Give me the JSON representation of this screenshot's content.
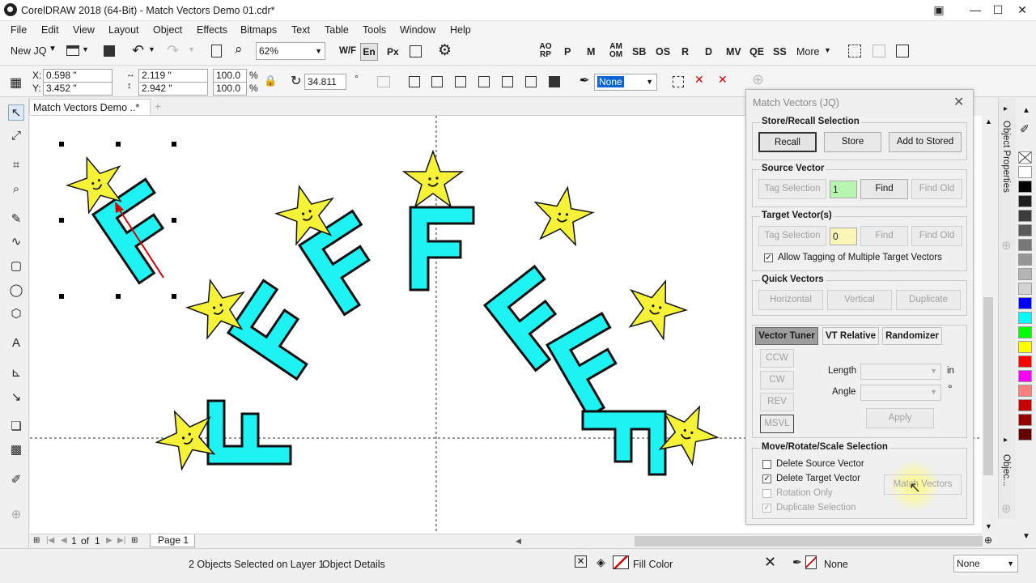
{
  "window": {
    "title": "CorelDRAW 2018 (64-Bit) - Match Vectors Demo 01.cdr*"
  },
  "menu": [
    "File",
    "Edit",
    "View",
    "Layout",
    "Object",
    "Effects",
    "Bitmaps",
    "Text",
    "Table",
    "Tools",
    "Window",
    "Help"
  ],
  "toolbar": {
    "new_label": "New JQ",
    "zoom": "62%",
    "wf": "W/F",
    "en": "En",
    "px": "Px",
    "macro_buttons": [
      "AO RP",
      "P",
      "M",
      "AM OM",
      "SB",
      "OS",
      "R",
      "D",
      "MV",
      "QE",
      "SS"
    ],
    "more": "More"
  },
  "propbar": {
    "x": "0.598 \"",
    "y": "3.452 \"",
    "w": "2.119 \"",
    "h": "2.942 \"",
    "scale_x": "100.0",
    "scale_y": "100.0",
    "pct": "%",
    "rotation": "34.811",
    "outline": "None"
  },
  "document_tab": "Match Vectors Demo ..*",
  "pager": {
    "current": "1",
    "of": "of",
    "total": "1",
    "page_tab": "Page 1"
  },
  "status": {
    "selection": "2 Objects Selected on Layer 1",
    "details": "Object Details",
    "fill": "Fill Color",
    "outline": "None",
    "outline_select": "None"
  },
  "dialog": {
    "title": "Match Vectors (JQ)",
    "store_recall": {
      "title": "Store/Recall Selection",
      "recall": "Recall",
      "store": "Store",
      "add": "Add to Stored"
    },
    "source": {
      "title": "Source Vector",
      "tag": "Tag Selection",
      "value": "1",
      "find": "Find",
      "find_old": "Find Old"
    },
    "target": {
      "title": "Target Vector(s)",
      "tag": "Tag Selection",
      "value": "0",
      "find": "Find",
      "find_old": "Find Old",
      "allow": "Allow Tagging of Multiple Target Vectors"
    },
    "quick": {
      "title": "Quick Vectors",
      "horizontal": "Horizontal",
      "vertical": "Vertical",
      "duplicate": "Duplicate"
    },
    "tabs": [
      "Vector Tuner",
      "VT Relative",
      "Randomizer"
    ],
    "tuner": {
      "ccw": "CCW",
      "cw": "CW",
      "rev": "REV",
      "msvl": "MSVL",
      "length": "Length",
      "angle": "Angle",
      "unit_in": "in",
      "unit_deg": "°",
      "apply": "Apply"
    },
    "mrs": {
      "title": "Move/Rotate/Scale Selection",
      "delete_source": "Delete Source Vector",
      "delete_target": "Delete Target Vector",
      "rotation_only": "Rotation Only",
      "duplicate_selection": "Duplicate Selection",
      "match": "Match Vectors"
    }
  },
  "dock": {
    "object_properties": "Object Properties",
    "objects": "Objec..."
  },
  "palette": [
    "#ffffff",
    "#000000",
    "#1e1e1e",
    "#3c3c3c",
    "#5a5a5a",
    "#787878",
    "#969696",
    "#b4b4b4",
    "#d2d2d2",
    "#0000ff",
    "#00ffff",
    "#00ff00",
    "#ffff00",
    "#ff0000",
    "#ff00ff",
    "#ff7f7f",
    "#c80000",
    "#960000",
    "#640000"
  ]
}
